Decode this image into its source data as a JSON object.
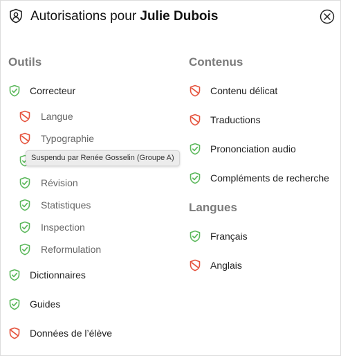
{
  "header": {
    "title_prefix": "Autorisations pour ",
    "title_name": "Julie Dubois",
    "icon": "shield-person-icon",
    "close_icon": "close-icon"
  },
  "colors": {
    "granted": "#5cb85c",
    "denied": "#e5533d"
  },
  "outils": {
    "title": "Outils",
    "items": [
      {
        "label": "Correcteur",
        "status": "granted"
      },
      {
        "label": "Langue",
        "status": "denied"
      },
      {
        "label": "Typographie",
        "status": "denied"
      },
      {
        "label": "",
        "status": "granted"
      },
      {
        "label": "Révision",
        "status": "granted"
      },
      {
        "label": "Statistiques",
        "status": "granted"
      },
      {
        "label": "Inspection",
        "status": "granted"
      },
      {
        "label": "Reformulation",
        "status": "granted"
      },
      {
        "label": "Dictionnaires",
        "status": "granted"
      },
      {
        "label": "Guides",
        "status": "granted"
      },
      {
        "label": "Données de l’élève",
        "status": "denied"
      }
    ]
  },
  "contenus": {
    "title": "Contenus",
    "items": [
      {
        "label": "Contenu délicat",
        "status": "denied"
      },
      {
        "label": "Traductions",
        "status": "denied"
      },
      {
        "label": "Prononciation audio",
        "status": "granted"
      },
      {
        "label": "Compléments de recherche",
        "status": "granted"
      }
    ]
  },
  "langues": {
    "title": "Langues",
    "items": [
      {
        "label": "Français",
        "status": "granted"
      },
      {
        "label": "Anglais",
        "status": "denied"
      }
    ]
  },
  "tooltip": {
    "text": "Suspendu par Renée Gosselin (Groupe A)"
  }
}
